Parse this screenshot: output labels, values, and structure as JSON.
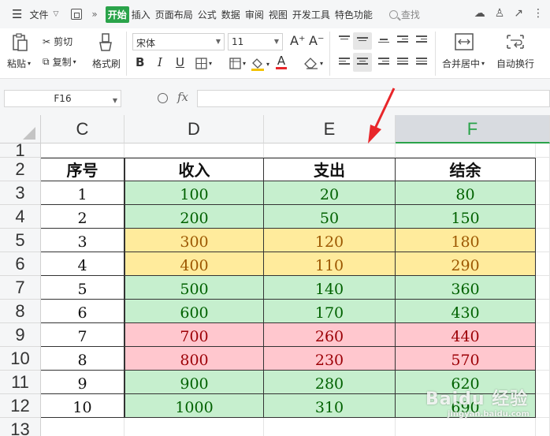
{
  "menubar": {
    "file_label": "文件",
    "more_label": "»",
    "tabs": [
      "开始",
      "插入",
      "页面布局",
      "公式",
      "数据",
      "审阅",
      "视图",
      "开发工具",
      "特色功能"
    ],
    "search_label": "查找"
  },
  "ribbon": {
    "paste_label": "粘贴",
    "cut_label": "剪切",
    "copy_label": "复制",
    "format_painter_label": "格式刷",
    "font_name": "宋体",
    "font_size": "11",
    "bold": "B",
    "italic": "I",
    "underline": "U",
    "grow_font": "A⁺",
    "shrink_font": "A⁻",
    "font_color_letter": "A",
    "merge_label": "合并居中",
    "wrap_label": "自动换行"
  },
  "formula_bar": {
    "cell_ref": "F16",
    "fx_label": "fx",
    "formula_value": ""
  },
  "sheet": {
    "columns": [
      "C",
      "D",
      "E",
      "F"
    ],
    "selected_column": "F",
    "rows": [
      "1",
      "2",
      "3",
      "4",
      "5",
      "6",
      "7",
      "8",
      "9",
      "10",
      "11",
      "12",
      "13"
    ],
    "headers": [
      "序号",
      "收入",
      "支出",
      "结余"
    ],
    "data": [
      {
        "seq": "1",
        "income": "100",
        "expense": "20",
        "balance": "80",
        "status": "green"
      },
      {
        "seq": "2",
        "income": "200",
        "expense": "50",
        "balance": "150",
        "status": "green"
      },
      {
        "seq": "3",
        "income": "300",
        "expense": "120",
        "balance": "180",
        "status": "yellow"
      },
      {
        "seq": "4",
        "income": "400",
        "expense": "110",
        "balance": "290",
        "status": "yellow"
      },
      {
        "seq": "5",
        "income": "500",
        "expense": "140",
        "balance": "360",
        "status": "green"
      },
      {
        "seq": "6",
        "income": "600",
        "expense": "170",
        "balance": "430",
        "status": "green"
      },
      {
        "seq": "7",
        "income": "700",
        "expense": "260",
        "balance": "440",
        "status": "red"
      },
      {
        "seq": "8",
        "income": "800",
        "expense": "230",
        "balance": "570",
        "status": "red"
      },
      {
        "seq": "9",
        "income": "900",
        "expense": "280",
        "balance": "620",
        "status": "green"
      },
      {
        "seq": "10",
        "income": "1000",
        "expense": "310",
        "balance": "690",
        "status": "green"
      }
    ]
  },
  "colors": {
    "accent": "#2aa34a",
    "green_fill": "#c6efce",
    "green_text": "#006100",
    "yellow_fill": "#ffeb9c",
    "yellow_text": "#9c5700",
    "red_fill": "#ffc7ce",
    "red_text": "#9c0006",
    "arrow": "#e8262a"
  },
  "watermark": {
    "text": "Baidu 经验",
    "sub": "jingyan.baidu.com"
  }
}
